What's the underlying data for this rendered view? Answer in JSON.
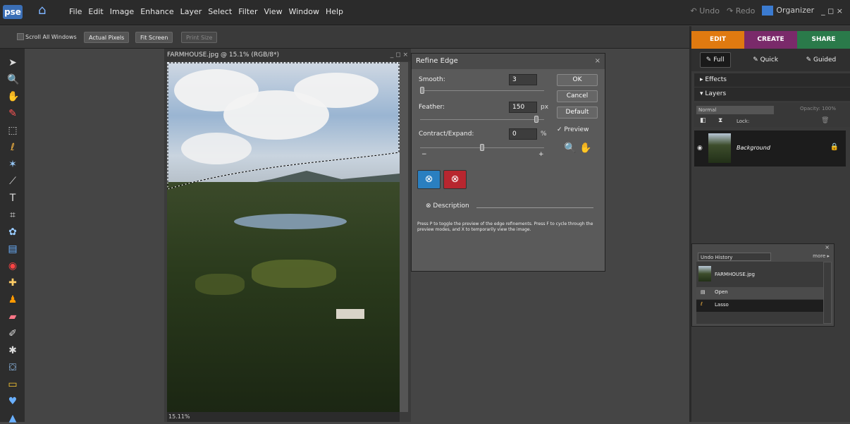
{
  "app": {
    "logo": "pse"
  },
  "menu": [
    "File",
    "Edit",
    "Image",
    "Enhance",
    "Layer",
    "Select",
    "Filter",
    "View",
    "Window",
    "Help"
  ],
  "topright": {
    "undo": "Undo",
    "redo": "Redo",
    "organizer": "Organizer",
    "window_controls": "_ ◻ ×"
  },
  "options": {
    "scroll_all": "Scroll All Windows",
    "actual_pixels": "Actual Pixels",
    "fit_screen": "Fit Screen",
    "print_size": "Print Size"
  },
  "document": {
    "title": "FARMHOUSE.jpg @ 15.1% (RGB/8*)",
    "zoom": "15.11%"
  },
  "dialog": {
    "title": "Refine Edge",
    "smooth_label": "Smooth:",
    "smooth_value": "3",
    "feather_label": "Feather:",
    "feather_value": "150",
    "feather_unit": "px",
    "contract_label": "Contract/Expand:",
    "contract_value": "0",
    "contract_unit": "%",
    "minus": "−",
    "plus": "+",
    "ok": "OK",
    "cancel": "Cancel",
    "default": "Default",
    "preview": "Preview",
    "description_label": "Description",
    "description_text": "Press P to toggle the preview of the edge refinements. Press F to cycle through the preview modes, and X to temporarily view the image.",
    "smooth_level": 0.0,
    "feather_level": 0.95,
    "contract_level": 0.5
  },
  "panel": {
    "tabs": [
      "EDIT",
      "CREATE",
      "SHARE"
    ],
    "tab_colors": [
      "#e07a10",
      "#7a2a6a",
      "#2a7a4a"
    ],
    "modes": [
      "Full",
      "Quick",
      "Guided"
    ],
    "effects": "Effects",
    "layers": "Layers",
    "blend_mode": "Normal",
    "opacity_label": "Opacity:",
    "opacity_value": "100%",
    "lock_label": "Lock:",
    "layer_name": "Background"
  },
  "undo_history": {
    "tab": "Undo History",
    "more": "more ▸",
    "close": "×",
    "items": [
      "FARMHOUSE.jpg",
      "Open",
      "Lasso"
    ]
  }
}
